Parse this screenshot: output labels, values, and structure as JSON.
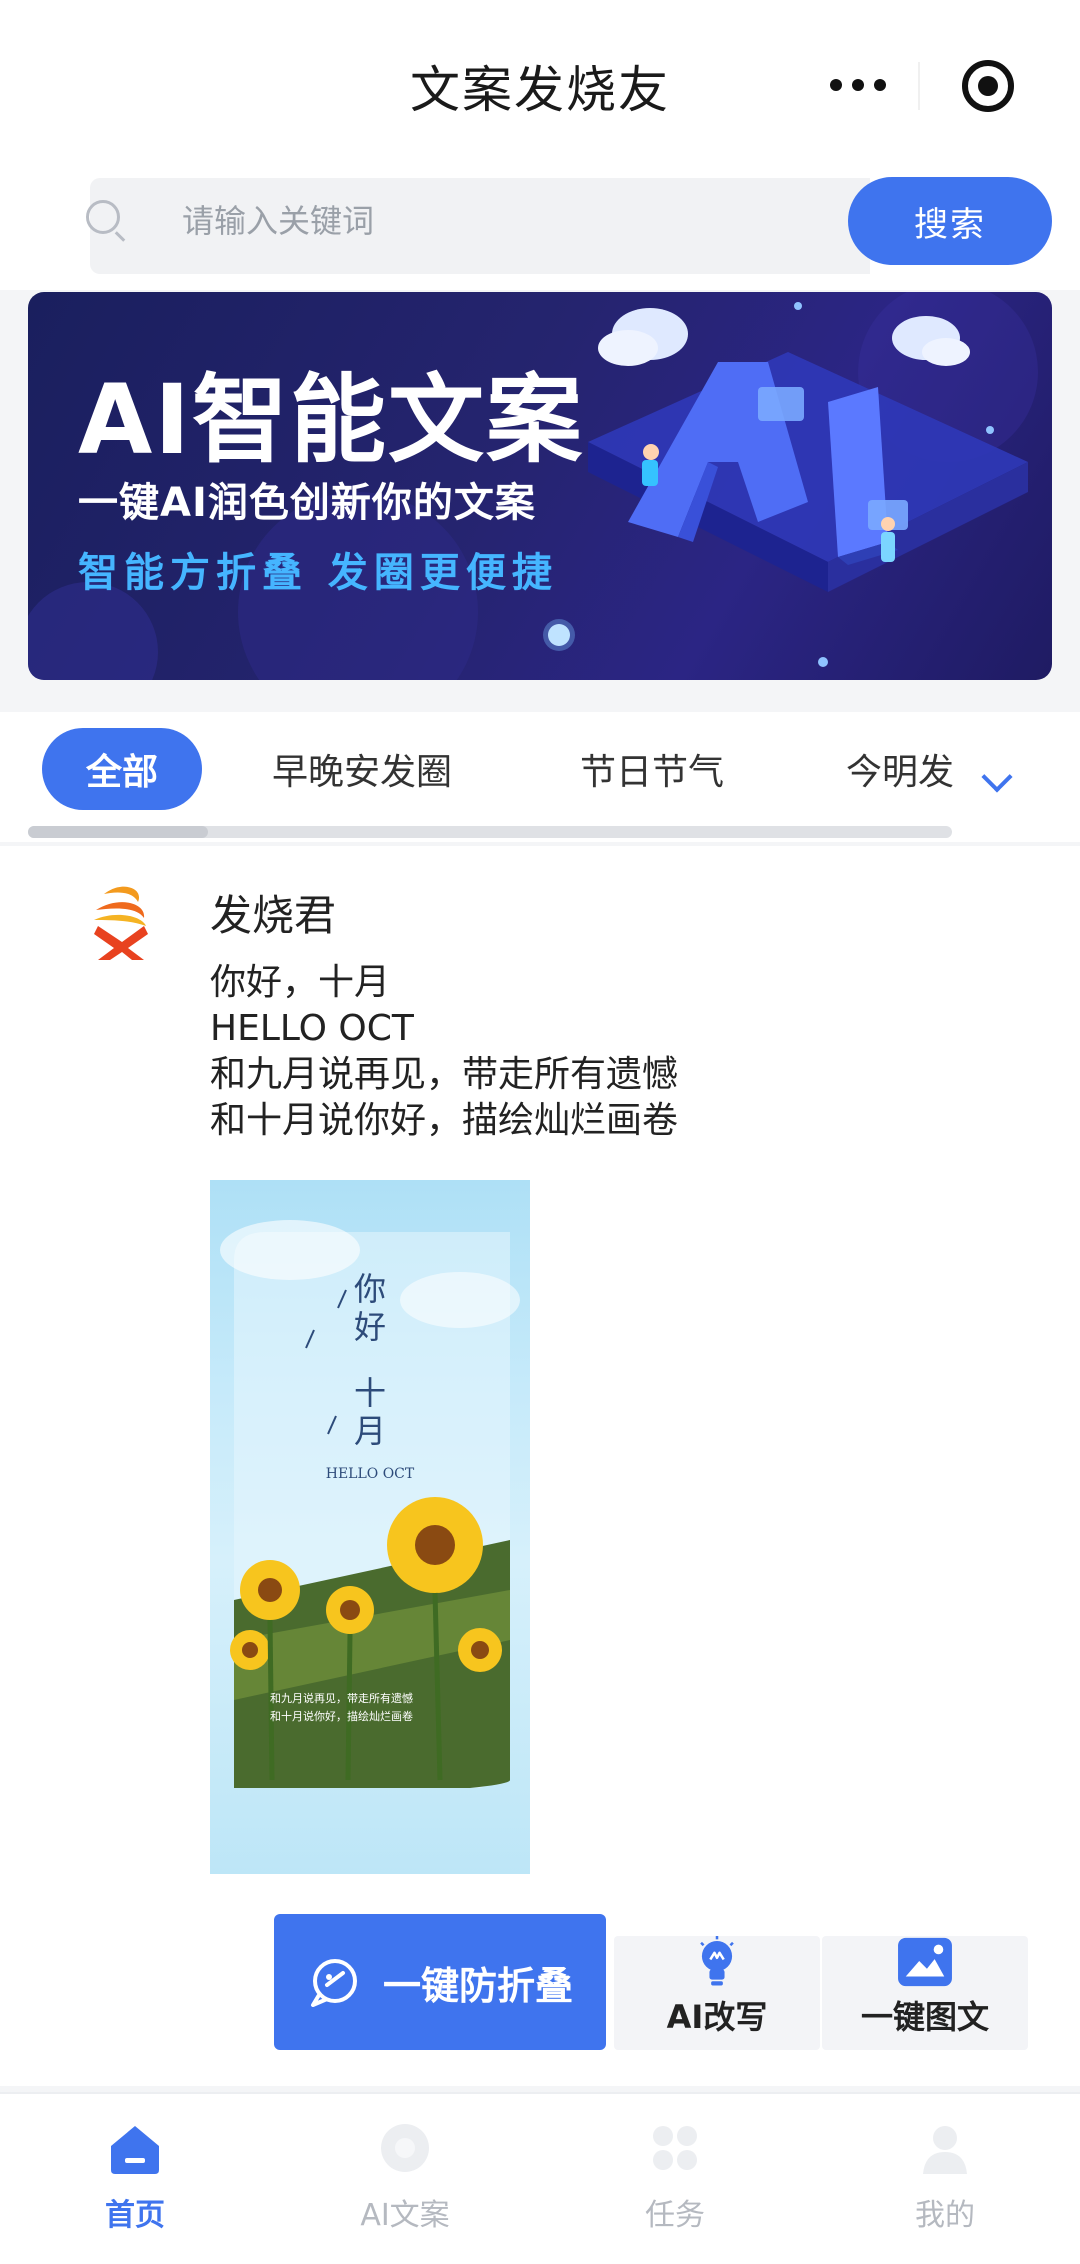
{
  "header": {
    "title": "文案发烧友"
  },
  "search": {
    "placeholder": "请输入关键词",
    "button_label": "搜索"
  },
  "banner": {
    "title": "AI智能文案",
    "subtitle": "一键AI润色创新你的文案",
    "tagline": "智能方折叠 发圈更便捷",
    "ai_letters": "AI",
    "active_slide": 1,
    "slide_count": 1
  },
  "tabs": {
    "items": [
      "全部",
      "早晚安发圈",
      "节日节气",
      "今明发"
    ],
    "active_index": 0
  },
  "post": {
    "author": "发烧君",
    "lines": [
      "你好，十月",
      "HELLO OCT",
      "和九月说再见，带走所有遗憾",
      "和十月说你好，描绘灿烂画卷"
    ],
    "image": {
      "title_1": "你好",
      "title_2": "十月",
      "caption": "HELLO OCT",
      "footer_1": "和九月说再见，带走所有遗憾",
      "footer_2": "和十月说你好，描绘灿烂画卷"
    }
  },
  "actions": {
    "fold_label": "一键防折叠",
    "rewrite_label": "AI改写",
    "image_text_label": "一键图文"
  },
  "tabbar": {
    "items": [
      "首页",
      "AI文案",
      "任务",
      "我的"
    ],
    "active_index": 0
  },
  "colors": {
    "accent": "#3f74ee",
    "banner_bg": "#25246f",
    "banner_highlight": "#45b5ff"
  }
}
